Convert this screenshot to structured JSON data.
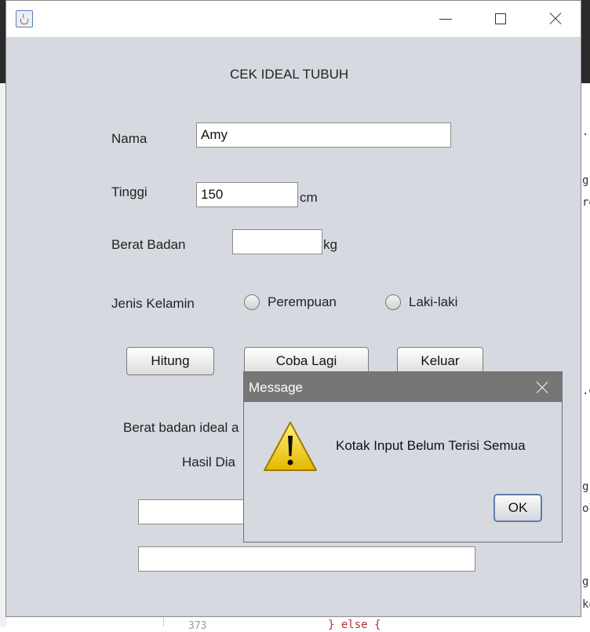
{
  "frame": {
    "heading": "CEK IDEAL TUBUH",
    "nama_label": "Nama",
    "nama_value": "Amy",
    "tinggi_label": "Tinggi",
    "tinggi_value": "150",
    "tinggi_unit": "cm",
    "berat_label": "Berat Badan",
    "berat_value": "",
    "berat_unit": "kg",
    "gender_label": "Jenis Kelamin",
    "gender_options": [
      "Perempuan",
      "Laki-laki"
    ],
    "buttons": {
      "hitung": "Hitung",
      "coba_lagi": "Coba Lagi",
      "keluar": "Keluar"
    },
    "result_label": "Berat badan ideal a",
    "diagnosis_label": "Hasil Dia",
    "result_value": "",
    "diagnosis_value": ""
  },
  "dialog": {
    "title": "Message",
    "message": "Kotak Input Belum Terisi Semua",
    "ok_label": "OK"
  },
  "background": {
    "code_fragments": [
      ".",
      "g",
      "re",
      ".d",
      "g",
      "ol",
      "g",
      "ko",
      "} else {"
    ],
    "line_number": "373"
  },
  "colors": {
    "frame_bg": "#d7d9e0",
    "dialog_title_bg": "#767676",
    "warning_yellow": "#f5d320"
  }
}
